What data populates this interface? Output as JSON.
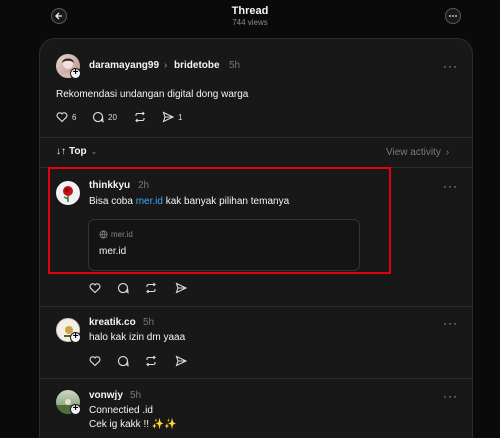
{
  "header": {
    "title": "Thread",
    "views": "744 views",
    "back_icon": "arrow-left-icon",
    "more_icon": "ellipsis-icon"
  },
  "colors": {
    "background": "#0a0a0a",
    "card": "#181818",
    "link": "#3fa9f5",
    "highlight": "#e3000f"
  },
  "post": {
    "author": "daramayang99",
    "reply_to": "bridetobe",
    "time": "5h",
    "text": "Rekomendasi undangan digital dong warga",
    "likes": "6",
    "comments": "20",
    "reposts": "",
    "shares": "1"
  },
  "sort": {
    "label": "Top",
    "view_activity": "View activity"
  },
  "replies": [
    {
      "author": "thinkkyu",
      "time": "2h",
      "text_before": "Bisa coba ",
      "link_text": "mer.id",
      "text_after": " kak banyak pilihan temanya",
      "preview": {
        "domain": "mer.id",
        "title": "mer.id"
      }
    },
    {
      "author": "kreatik.co",
      "time": "5h",
      "text": "halo kak izin dm yaaa"
    },
    {
      "author": "vonwjy",
      "time": "5h",
      "line1": "Connectied .id",
      "line2": "Cek ig kakk !! ✨✨"
    }
  ],
  "more_label": "···"
}
